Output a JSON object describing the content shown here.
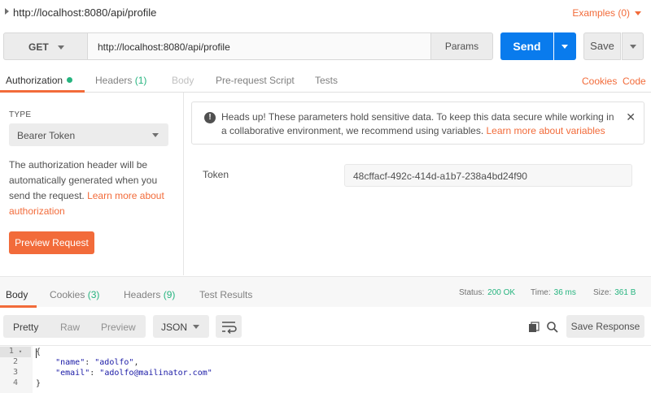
{
  "request": {
    "title": "http://localhost:8080/api/profile",
    "examples_label": "Examples (0)",
    "method": "GET",
    "url": "http://localhost:8080/api/profile",
    "params_label": "Params",
    "send_label": "Send",
    "save_label": "Save"
  },
  "request_tabs": {
    "authorization": "Authorization",
    "headers": "Headers",
    "headers_count": "(1)",
    "body": "Body",
    "prerequest": "Pre-request Script",
    "tests": "Tests",
    "cookies": "Cookies",
    "code": "Code"
  },
  "auth": {
    "type_label": "TYPE",
    "type_value": "Bearer Token",
    "description": "The authorization header will be automatically generated when you send the request. ",
    "description_link": "Learn more about authorization",
    "preview_label": "Preview Request",
    "alert_text": "Heads up! These parameters hold sensitive data. To keep this data secure while working in a collaborative environment, we recommend using variables. ",
    "alert_link": "Learn more about variables",
    "token_label": "Token",
    "token_value": "48cffacf-492c-414d-a1b7-238a4bd24f90"
  },
  "response_tabs": {
    "body": "Body",
    "cookies": "Cookies",
    "cookies_count": "(3)",
    "headers": "Headers",
    "headers_count": "(9)",
    "tests": "Test Results"
  },
  "status": {
    "status_label": "Status:",
    "status_value": "200 OK",
    "time_label": "Time:",
    "time_value": "36 ms",
    "size_label": "Size:",
    "size_value": "361 B"
  },
  "response_toolbar": {
    "pretty": "Pretty",
    "raw": "Raw",
    "preview": "Preview",
    "format": "JSON",
    "save_response": "Save Response"
  },
  "code": {
    "line_numbers": [
      "1",
      "2",
      "3",
      "4"
    ],
    "open_brace": "{",
    "name_key": "\"name\"",
    "name_val": "\"adolfo\"",
    "email_key": "\"email\"",
    "email_val": "\"adolfo@mailinator.com\"",
    "close_brace": "}"
  },
  "colors": {
    "accent": "#f26b3a",
    "send_blue": "#097bed",
    "success_green": "#26b47f"
  }
}
